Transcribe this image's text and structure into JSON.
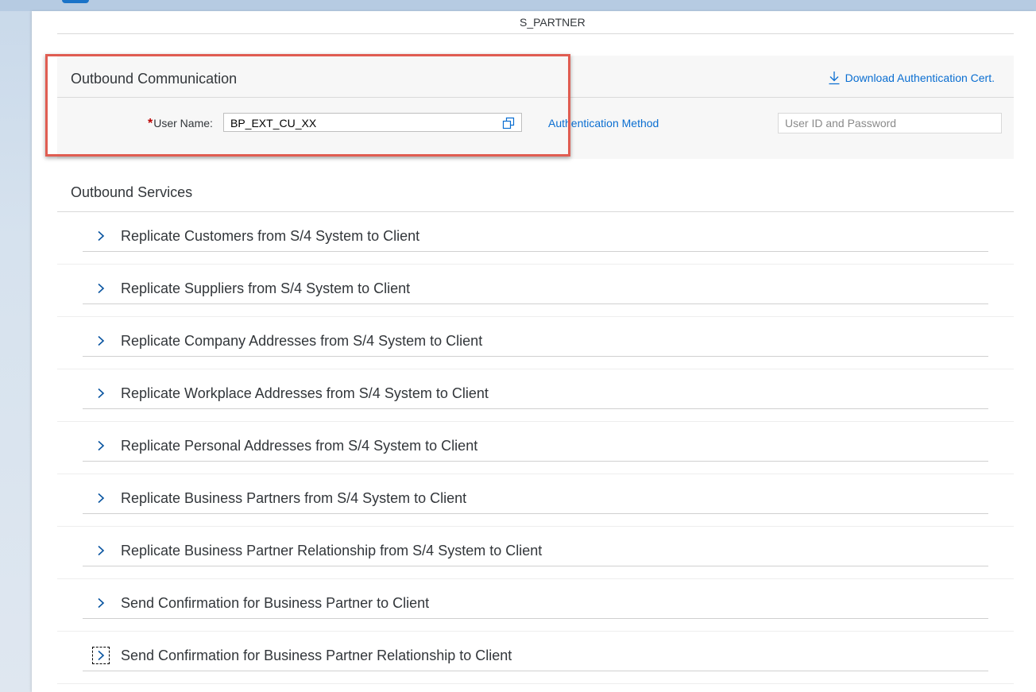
{
  "header": {
    "top_field_value": "S_PARTNER"
  },
  "outbound_communication": {
    "title": "Outbound Communication",
    "download_label": "Download Authentication Cert.",
    "user_name_required_mark": "*",
    "user_name_label": "User Name:",
    "user_name_value": "BP_EXT_CU_XX",
    "auth_method_label": "Authentication Method",
    "auth_method_placeholder": "User ID and Password"
  },
  "outbound_services": {
    "title": "Outbound Services",
    "items": [
      {
        "label": "Replicate Customers from S/4 System to Client"
      },
      {
        "label": "Replicate Suppliers from S/4 System to Client"
      },
      {
        "label": "Replicate Company Addresses from S/4 System to Client"
      },
      {
        "label": "Replicate Workplace Addresses from S/4 System to Client"
      },
      {
        "label": "Replicate Personal Addresses from S/4 System to Client"
      },
      {
        "label": "Replicate Business Partners from S/4 System to Client"
      },
      {
        "label": "Replicate Business Partner Relationship from S/4 System to Client"
      },
      {
        "label": "Send Confirmation for Business Partner to Client"
      },
      {
        "label": "Send Confirmation for Business Partner Relationship to Client"
      }
    ]
  },
  "colors": {
    "link": "#0a6ed1",
    "required": "#bb0000",
    "highlight": "#e05d52",
    "text": "#32363a"
  },
  "icons": {
    "download": "download-icon",
    "value_help": "value-help-icon",
    "expand": "chevron-right-icon"
  }
}
